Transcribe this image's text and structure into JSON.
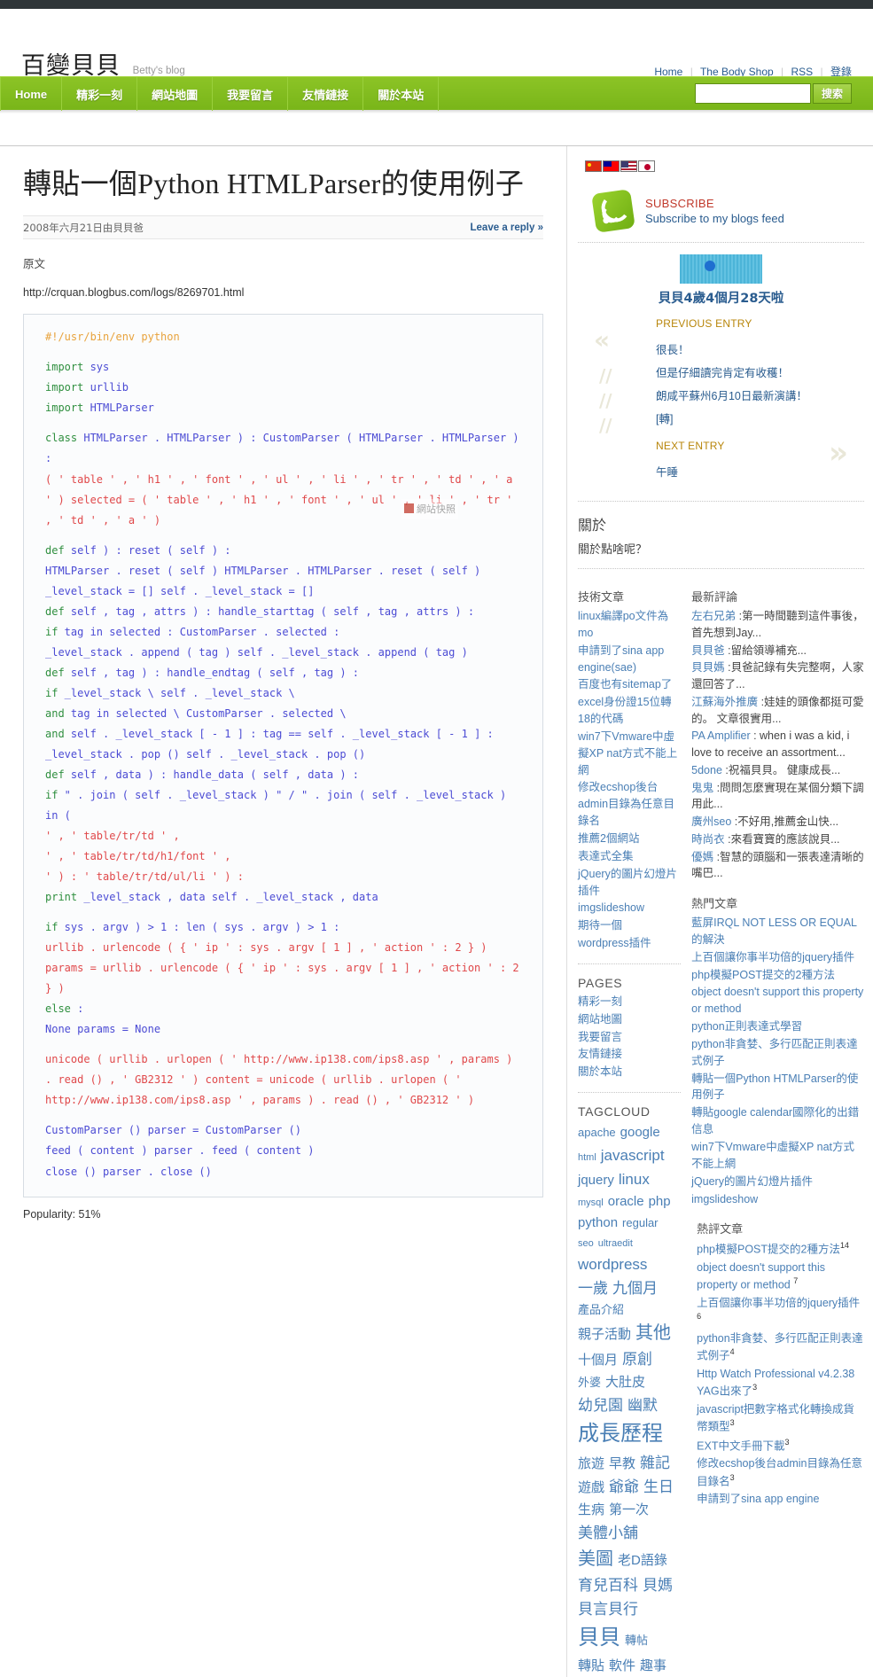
{
  "header": {
    "site_title": "百變貝貝",
    "tagline": "Betty's blog",
    "links": [
      {
        "label": "Home"
      },
      {
        "label": "The Body Shop"
      },
      {
        "label": "RSS"
      },
      {
        "label": "登錄"
      }
    ]
  },
  "nav": {
    "items": [
      {
        "label": "Home",
        "latin": true
      },
      {
        "label": "精彩一刻",
        "latin": false
      },
      {
        "label": "網站地圖",
        "latin": false
      },
      {
        "label": "我要留言",
        "latin": false
      },
      {
        "label": "友情鏈接",
        "latin": false
      },
      {
        "label": "關於本站",
        "latin": false
      }
    ],
    "search": {
      "value": "",
      "placeholder": "",
      "button_label": "搜索"
    }
  },
  "post": {
    "title": "轉貼一個Python HTMLParser的使用例子",
    "date": "2008年六月21日由貝貝爸",
    "reply_link": "Leave a reply »",
    "intro_label": "原文",
    "source_url": "http://crquan.blogbus.com/logs/8269701.html",
    "popularity": "Popularity: 51%",
    "watermark": "網站快照",
    "code_lines": [
      {
        "type": "comment",
        "text": "#!/usr/bin/env python"
      },
      {
        "type": "blank",
        "text": ""
      },
      {
        "type": "code",
        "text": "import sys",
        "kw": "import"
      },
      {
        "type": "code",
        "text": "import urllib",
        "kw": "import"
      },
      {
        "type": "code",
        "text": "import HTMLParser",
        "kw": "import"
      },
      {
        "type": "blank",
        "text": ""
      },
      {
        "type": "code",
        "text": "class HTMLParser . HTMLParser ) : CustomParser ( HTMLParser . HTMLParser ) :",
        "kw": "class"
      },
      {
        "type": "str",
        "text": "( ' table ' , ' h1 ' , ' font ' , ' ul ' , ' li ' , ' tr ' , ' td ' , ' a ' ) selected = ( ' table ' , ' h1 ' , ' font ' , ' ul ' , ' li ' , ' tr ' , ' td ' , ' a ' )"
      },
      {
        "type": "blank",
        "text": ""
      },
      {
        "type": "code",
        "text": "def self ) : reset ( self ) :",
        "kw": "def"
      },
      {
        "type": "plain",
        "text": "HTMLParser . reset ( self ) HTMLParser . HTMLParser . reset ( self )"
      },
      {
        "type": "plain",
        "text": "_level_stack = [] self . _level_stack = []"
      },
      {
        "type": "code",
        "text": "def self , tag , attrs ) : handle_starttag ( self , tag , attrs ) :",
        "kw": "def"
      },
      {
        "type": "code",
        "text": "if tag in selected : CustomParser . selected :",
        "kw": "if"
      },
      {
        "type": "plain",
        "text": "_level_stack . append ( tag ) self . _level_stack . append ( tag )"
      },
      {
        "type": "code",
        "text": "def self , tag ) : handle_endtag ( self , tag ) :",
        "kw": "def"
      },
      {
        "type": "code",
        "text": "if _level_stack \\ self . _level_stack \\",
        "kw": "if"
      },
      {
        "type": "code",
        "text": "and tag in selected \\ CustomParser . selected \\",
        "kw": "and"
      },
      {
        "type": "code",
        "text": "and self . _level_stack [ - 1 ] : tag == self . _level_stack [ - 1 ] :",
        "kw": "and"
      },
      {
        "type": "plain",
        "text": "_level_stack . pop () self . _level_stack . pop ()"
      },
      {
        "type": "code",
        "text": "def self , data ) : handle_data ( self , data ) :",
        "kw": "def"
      },
      {
        "type": "code",
        "text": "if \" . join ( self . _level_stack ) \" / \" . join ( self . _level_stack ) in (",
        "kw": "if"
      },
      {
        "type": "str",
        "text": "' , ' table/tr/td ' ,"
      },
      {
        "type": "str",
        "text": "' , ' table/tr/td/h1/font ' ,"
      },
      {
        "type": "str",
        "text": "' ) : ' table/tr/td/ul/li ' ) :"
      },
      {
        "type": "code",
        "text": "print _level_stack , data self . _level_stack , data",
        "kw": "print"
      },
      {
        "type": "blank",
        "text": ""
      },
      {
        "type": "code",
        "text": "if sys . argv ) > 1 : len ( sys . argv ) > 1 :",
        "kw": "if"
      },
      {
        "type": "str",
        "text": "urllib . urlencode ( { ' ip ' : sys . argv [ 1 ] , ' action ' : 2 } ) params = urllib . urlencode ( { ' ip ' : sys . argv [ 1 ] , ' action ' : 2 } )"
      },
      {
        "type": "code",
        "text": "else :",
        "kw": "else"
      },
      {
        "type": "plain",
        "text": "None params = None"
      },
      {
        "type": "blank",
        "text": ""
      },
      {
        "type": "str",
        "text": "unicode ( urllib . urlopen ( ' http://www.ip138.com/ips8.asp ' , params ) . read () , ' GB2312 ' ) content = unicode ( urllib . urlopen ( ' http://www.ip138.com/ips8.asp ' , params ) . read () , ' GB2312 ' )"
      },
      {
        "type": "blank",
        "text": ""
      },
      {
        "type": "plain",
        "text": "CustomParser () parser = CustomParser ()"
      },
      {
        "type": "plain",
        "text": "feed ( content ) parser . feed ( content )"
      },
      {
        "type": "plain",
        "text": "close () parser . close ()"
      }
    ]
  },
  "sidebar": {
    "flags": [
      "flag-cn-icon",
      "flag-tw-icon",
      "flag-us-icon",
      "flag-jp-icon"
    ],
    "subscribe": {
      "icon": "rss-icon",
      "title": "SUBSCRIBE",
      "subtitle": "Subscribe to my blogs feed"
    },
    "age_widget": {
      "text": "貝貝4歲4個月28天啦"
    },
    "entries": {
      "previous_head": "PREVIOUS ENTRY",
      "previous_items": [
        "很長！",
        "但是仔細讀完肯定有收穫！",
        "朗咸平蘇州6月10日最新演講！",
        "[轉]"
      ],
      "next_head": "NEXT ENTRY",
      "next_item": "午睡"
    },
    "about": {
      "title": "關於",
      "text": "關於點啥呢？"
    },
    "tech": {
      "title": "技術文章",
      "items": [
        "linux編譯po文件為mo",
        "申請到了sina app engine(sae)",
        "百度也有sitemap了",
        "excel身份證15位轉18的代碼",
        "win7下Vmware中虛擬XP nat方式不能上網",
        "修改ecshop後台admin目錄為任意目錄名",
        "推薦2個網站",
        "表達式全集",
        "jQuery的圖片幻燈片插件",
        "imgslideshow",
        "期待一個",
        "wordpress插件"
      ]
    },
    "comments": {
      "title": "最新評論",
      "items": [
        {
          "who": "左右兄弟",
          "text": " :第一時間聽到這件事後，首先想到Jay..."
        },
        {
          "who": "貝貝爸",
          "text": " :留給領導補充..."
        },
        {
          "who": "貝貝媽",
          "text": " :貝爸記錄有失完整啊，人家還回答了..."
        },
        {
          "who": "江蘇海外推廣",
          "text": " :娃娃的頭像都挺可愛的。 文章很實用..."
        },
        {
          "who": "PA Amplifier",
          "text": " : when i was a kid, i love to receive an assortment..."
        },
        {
          "who": "5done",
          "text": " :祝福貝貝。 健康成長..."
        },
        {
          "who": "鬼鬼",
          "text": " :問問怎麼實現在某個分類下調用此..."
        },
        {
          "who": "廣州seo",
          "text": " :不好用,推薦金山快..."
        },
        {
          "who": "時尚衣",
          "text": " :來看寶寶的應該說貝..."
        },
        {
          "who": "優媽",
          "text": " :智慧的頭腦和一張表達清晰的嘴巴..."
        }
      ]
    },
    "pages": {
      "title": "PAGES",
      "items": [
        "精彩一刻",
        "網站地圖",
        "我要留言",
        "友情鏈接",
        "關於本站"
      ]
    },
    "popular": {
      "title": "熱門文章",
      "items": [
        "藍屏IRQL NOT LESS OR EQUAL的解決",
        "上百個讓你事半功倍的jquery插件",
        "php模擬POST提交的2種方法",
        "object doesn't support this property or method",
        "python正則表達式學習",
        "python非貪婪、多行匹配正則表達式例子",
        "轉貼一個Python HTMLParser的使用例子",
        "轉貼google calendar國際化的出錯信息",
        "win7下Vmware中虛擬XP nat方式不能上網",
        "jQuery的圖片幻燈片插件",
        "imgslideshow"
      ]
    },
    "hot_comments": {
      "title": "熱評文章",
      "items": [
        {
          "text": "php模擬POST提交的2種方法",
          "count": "14"
        },
        {
          "text": "object doesn't support this property or method ",
          "count": "7"
        },
        {
          "text": "上百個讓你事半功倍的jquery插件",
          "count": "6"
        },
        {
          "text": "python非貪婪、多行匹配正則表達式例子",
          "count": "4"
        },
        {
          "text": "Http Watch Professional v4.2.38 YAG出來了",
          "count": "3"
        },
        {
          "text": "javascript把數字格式化轉換成貨幣類型",
          "count": "3"
        },
        {
          "text": "EXT中文手冊下載",
          "count": "3"
        },
        {
          "text": "修改ecshop後台admin目錄為任意目錄名",
          "count": "3"
        },
        {
          "text": "申請到了sina app engine",
          "count": ""
        }
      ]
    },
    "tagcloud": {
      "title": "TAGCLOUD",
      "tags": [
        {
          "label": "apache",
          "size": "t2"
        },
        {
          "label": "google",
          "size": "t3"
        },
        {
          "label": "html",
          "size": "t1"
        },
        {
          "label": "javascript",
          "size": "t4"
        },
        {
          "label": "jquery",
          "size": "t3"
        },
        {
          "label": "linux",
          "size": "t4"
        },
        {
          "label": "mysql",
          "size": "t1"
        },
        {
          "label": "oracle",
          "size": "t3"
        },
        {
          "label": "php",
          "size": "t3"
        },
        {
          "label": "python",
          "size": "t3"
        },
        {
          "label": "regular",
          "size": "t2"
        },
        {
          "label": "seo",
          "size": "t1"
        },
        {
          "label": "ultraedit",
          "size": "t1"
        },
        {
          "label": "wordpress",
          "size": "t4"
        },
        {
          "label": "一歲",
          "size": "t4"
        },
        {
          "label": "九個月",
          "size": "t4"
        },
        {
          "label": "產品介紹",
          "size": "t2"
        },
        {
          "label": "親子活動",
          "size": "t3"
        },
        {
          "label": "其他",
          "size": "t5"
        },
        {
          "label": "十個月",
          "size": "t3"
        },
        {
          "label": "原創",
          "size": "t4"
        },
        {
          "label": "外婆",
          "size": "t2"
        },
        {
          "label": "大肚皮",
          "size": "t3"
        },
        {
          "label": "幼兒園",
          "size": "t4"
        },
        {
          "label": "幽默",
          "size": "t4"
        },
        {
          "label": "成長歷程",
          "size": "t6"
        },
        {
          "label": "旅遊",
          "size": "t3"
        },
        {
          "label": "早教",
          "size": "t3"
        },
        {
          "label": "雜記",
          "size": "t4"
        },
        {
          "label": "遊戲",
          "size": "t3"
        },
        {
          "label": "爺爺",
          "size": "t4"
        },
        {
          "label": "生日",
          "size": "t4"
        },
        {
          "label": "生病",
          "size": "t3"
        },
        {
          "label": "第一次",
          "size": "t3"
        },
        {
          "label": "美體小舖",
          "size": "t4"
        },
        {
          "label": "美圖",
          "size": "t5"
        },
        {
          "label": "老D語錄",
          "size": "t3"
        },
        {
          "label": "育兒百科",
          "size": "t4"
        },
        {
          "label": "貝媽",
          "size": "t4"
        },
        {
          "label": "貝言貝行",
          "size": "t4"
        },
        {
          "label": "貝貝",
          "size": "t6"
        },
        {
          "label": "轉帖",
          "size": "t2"
        },
        {
          "label": "轉貼",
          "size": "t3"
        },
        {
          "label": "軟件",
          "size": "t3"
        },
        {
          "label": "趣事",
          "size": "t3"
        }
      ]
    }
  }
}
